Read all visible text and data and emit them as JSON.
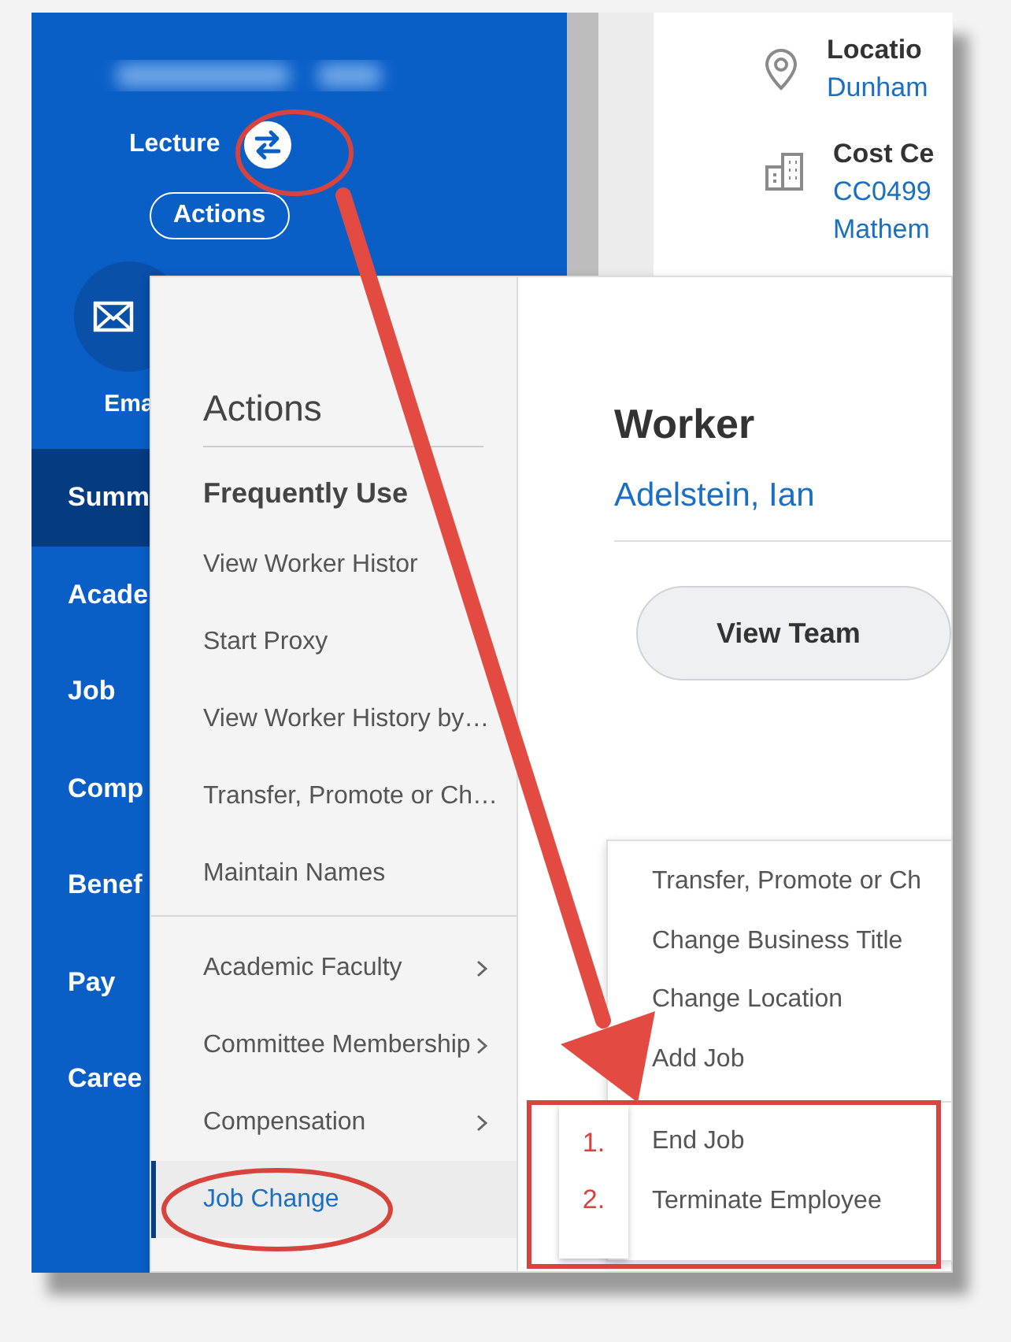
{
  "sidebar": {
    "title": "Lecture",
    "actions_button": "Actions",
    "email_label": "Ema",
    "nav_items": [
      {
        "label": "Summ",
        "selected": true
      },
      {
        "label": "Acade",
        "selected": false
      },
      {
        "label": "Job",
        "selected": false
      },
      {
        "label": "Comp",
        "selected": false
      },
      {
        "label": "Benef",
        "selected": false
      },
      {
        "label": "Pay",
        "selected": false
      },
      {
        "label": "Caree",
        "selected": false
      }
    ]
  },
  "details": [
    {
      "kind": "location",
      "label": "Locatio",
      "values": [
        "Dunham"
      ]
    },
    {
      "kind": "cost_center",
      "label": "Cost Ce",
      "values": [
        "CC0499",
        "Mathem"
      ]
    }
  ],
  "actions_menu": {
    "title": "Actions",
    "section_title": "Frequently Use",
    "frequent_items": [
      "View Worker Histor",
      "Start Proxy",
      "View Worker History by…",
      "Transfer, Promote or Ch…",
      "Maintain Names"
    ],
    "categories": [
      {
        "label": "Academic Faculty",
        "has_submenu": true,
        "selected": false
      },
      {
        "label": "Committee Membership",
        "has_submenu": true,
        "selected": false
      },
      {
        "label": "Compensation",
        "has_submenu": true,
        "selected": false
      },
      {
        "label": "Job Change",
        "has_submenu": false,
        "selected": true
      }
    ]
  },
  "worker_panel": {
    "title": "Worker",
    "name": "Adelstein, Ian",
    "button": "View Team"
  },
  "submenu": {
    "groups": [
      [
        "Transfer, Promote or Ch",
        "Change Business Title",
        "Change Location",
        "Add Job"
      ],
      [
        "End Job",
        "Terminate Employee"
      ]
    ]
  },
  "annotations": {
    "step_numbers": [
      "1.",
      "2."
    ]
  }
}
